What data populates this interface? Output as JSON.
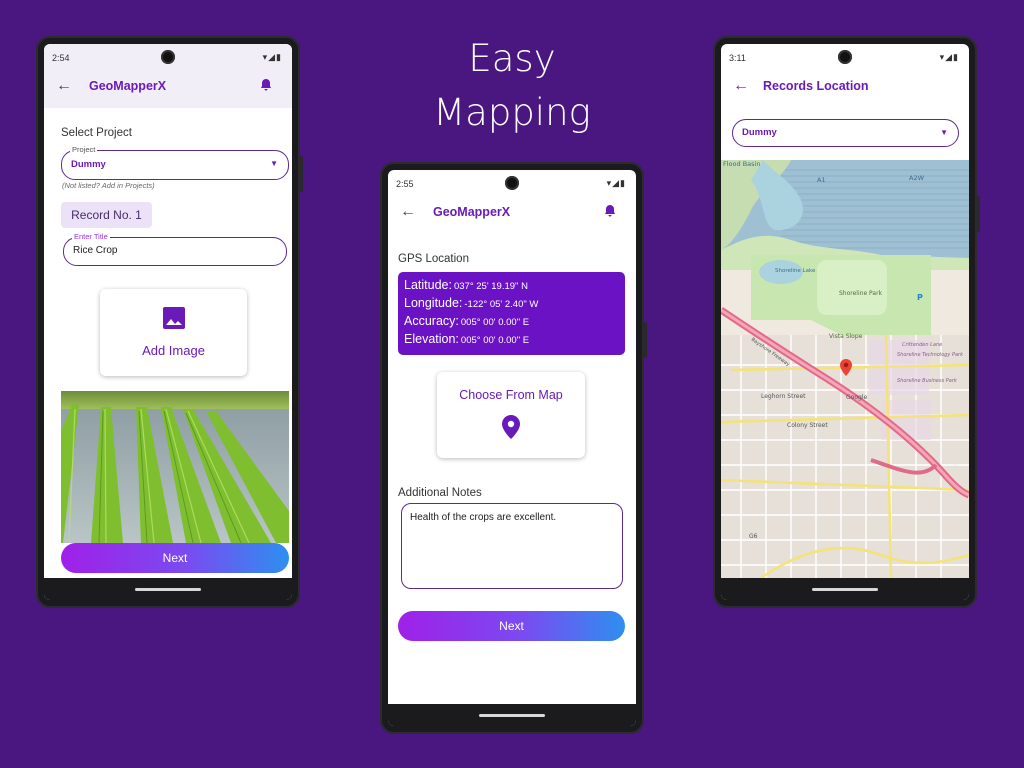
{
  "headline": {
    "line1": "Easy",
    "line2": "Mapping"
  },
  "phone1": {
    "status_time": "2:54",
    "app_title": "GeoMapperX",
    "select_project_label": "Select Project",
    "project_field_legend": "Project",
    "project_value": "Dummy",
    "project_hint": "(Not listed? Add in Projects)",
    "record_chip": "Record No. 1",
    "title_field_legend": "Enter Title",
    "title_value": "Rice Crop",
    "add_image_label": "Add Image",
    "next_label": "Next"
  },
  "phone2": {
    "status_time": "2:55",
    "app_title": "GeoMapperX",
    "gps_label": "GPS Location",
    "gps": [
      {
        "key": "Latitude:",
        "value": "037°  25'  19.19\"  N"
      },
      {
        "key": "Longitude:",
        "value": "-122°  05'  2.40\"  W"
      },
      {
        "key": "Accuracy:",
        "value": "005°  00'  0.00\"  E"
      },
      {
        "key": "Elevation:",
        "value": "005°  00'  0.00\"  E"
      }
    ],
    "choose_map_label": "Choose From Map",
    "notes_label": "Additional Notes",
    "notes_value": "Health of the crops are excellent.",
    "next_label": "Next"
  },
  "phone3": {
    "status_time": "3:11",
    "app_title": "Records Location",
    "project_value": "Dummy",
    "map_labels": {
      "flood_basin": "Flood Basin",
      "a1": "A1",
      "a2w": "A2W",
      "shoreline_lake": "Shoreline Lake",
      "shoreline_park": "Shoreline Park",
      "vista_slope": "Vista Slope",
      "crittenden": "Crittenden Lane",
      "shoreline_tech": "Shoreline Technology Park",
      "shoreline_business": "Shoreline Business Park",
      "google": "Google",
      "leghorn": "Leghorn Street",
      "colony": "Colony Street",
      "g6": "G6",
      "bayshore": "Bayshore Freeway",
      "p": "P"
    }
  },
  "colors": {
    "background": "#4a1780",
    "accent": "#6a1ab8",
    "gps_box": "#6b12c4",
    "pin": "#ea4335"
  }
}
